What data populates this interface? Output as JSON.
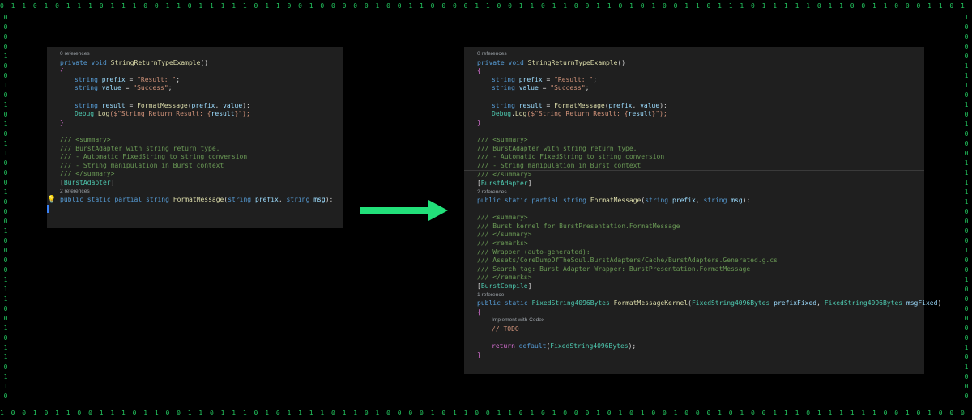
{
  "border": {
    "top": "0 1 1 0 1 0 1 1 1 0 1 1 1 0 0 1 1 0 1 1 1 1 1 0 1 1 0 0 1 0 0 0 0 0 1 0 0 1 1 0 0 0 0 1 1 0 0 1 1 0 1 1 0 0 1 1 0 1 0 1 0 0 1 1 0 1 1 1 0 1 1 1 1 1 0 1 1 0 0 1 1 0 0 0 1 1 0 1 1 0 1 1 1 1 1 1 0 1 1 0 1 0 0 1 1 1 1 1 1 0 0 1 1 0 1 0 0 1 1 1 0 1 1 0 0 0 0 1 0 0 0 0 1 1 0 0 0 1 1 0 0 0 1 1 0 0",
    "bottom": "1 0 0 1 0 1 1 0 0 1 1 1 0 1 1 0 0 1 1 0 1 1 1 0 1 0 1 1 1 1 0 1 1 0 1 0 0 0 0 1 0 1 1 0 0 1 1 0 1 0 1 0 0 0 1 0 1 0 1 0 0 1 0 0 0 1 0 1 0 0 1 1 1 0 1 1 1 1 1 1 0 0 1 0 1 0 0 0 1 0 1 0 1 0 1 1 0 0 1 1 1 0 1 0 1 0 0 0 1 1 0 1 0 1 1 1 1 1 1 0 1 0 1 0 1 0 1 1 1 0 1 0 0 0 1 0 0 1",
    "left": "0 0 0 0 1 0 0 1 0 1 0 1 0 1 1 0 0 0 1 0 0 0 1 0 0 0 0 1 1 1 0 0 1 0 1 1 0 1 1 0",
    "right": "1 0 0 0 0 1 1 1 0 1 0 1 0 0 0 1 1 1 1 1 0 0 0 0 1 0 0 1 0 0 0 0 0 0 1 0 1 0 0 0"
  },
  "left": {
    "refs0": "0 references",
    "sig": [
      "private",
      "void",
      "StringReturnTypeExample",
      "()"
    ],
    "open": "{",
    "l1": [
      "string",
      "prefix",
      " = ",
      "\"Result: \"",
      ";"
    ],
    "l2": [
      "string",
      "value",
      " = ",
      "\"Success\"",
      ";"
    ],
    "l3": [
      "string",
      "result",
      " = ",
      "FormatMessage",
      "(",
      "prefix",
      ", ",
      "value",
      ");"
    ],
    "l4": [
      "Debug",
      ".",
      "Log",
      "($\"String Return Result: {",
      "result",
      "}\");"
    ],
    "close": "}",
    "c1": "/// <summary>",
    "c2": "/// BurstAdapter with string return type.",
    "c3": "/// - Automatic FixedString to string conversion",
    "c4": "/// - String manipulation in Burst context",
    "c5": "/// </summary>",
    "attr": [
      "[",
      "BurstAdapter",
      "]"
    ],
    "refs2": "2 references",
    "decl": [
      "public",
      "static",
      "partial",
      "string",
      "FormatMessage",
      "(",
      "string",
      "prefix",
      ", ",
      "string",
      "msg",
      ");"
    ]
  },
  "right": {
    "refs0": "0 references",
    "sig": [
      "private",
      "void",
      "StringReturnTypeExample",
      "()"
    ],
    "open": "{",
    "l1": [
      "string",
      "prefix",
      " = ",
      "\"Result: \"",
      ";"
    ],
    "l2": [
      "string",
      "value",
      " = ",
      "\"Success\"",
      ";"
    ],
    "l3": [
      "string",
      "result",
      " = ",
      "FormatMessage",
      "(",
      "prefix",
      ", ",
      "value",
      ");"
    ],
    "l4": [
      "Debug",
      ".",
      "Log",
      "($\"String Return Result: {",
      "result",
      "}\");"
    ],
    "close": "}",
    "c1": "/// <summary>",
    "c2": "/// BurstAdapter with string return type.",
    "c3": "/// - Automatic FixedString to string conversion",
    "c4": "/// - String manipulation in Burst context",
    "c5": "/// </summary>",
    "attr": [
      "[",
      "BurstAdapter",
      "]"
    ],
    "refs2": "2 references",
    "decl": [
      "public",
      "static",
      "partial",
      "string",
      "FormatMessage",
      "(",
      "string",
      "prefix",
      ", ",
      "string",
      "msg",
      ");"
    ],
    "k1": "/// <summary>",
    "k2": "/// Burst kernel for BurstPresentation.FormatMessage",
    "k3": "/// </summary>",
    "k4": "/// <remarks>",
    "k5": "/// Wrapper (auto-generated):",
    "k6": "/// Assets/CoreDumpOfTheSoul.BurstAdapters/Cache/BurstAdapters.Generated.g.cs",
    "k7": "/// Search tag: Burst Adapter Wrapper: BurstPresentation.FormatMessage",
    "k8": "/// </remarks>",
    "attr2": [
      "[",
      "BurstCompile",
      "]"
    ],
    "refs1": "1 reference",
    "kernel": [
      "public",
      "static",
      "FixedString4096Bytes",
      "FormatMessageKernel",
      "(",
      "FixedString4096Bytes",
      "prefixFixed",
      ", ",
      "FixedString4096Bytes",
      "msgFixed",
      ")"
    ],
    "kopen": "{",
    "codex": "Implement with Codex",
    "todo": "// TODO",
    "ret": [
      "return",
      "default",
      "(",
      "FixedString4096Bytes",
      ");"
    ],
    "kclose": "}"
  },
  "colors": {
    "arrow": "#22e07a",
    "binary": "#22c55e"
  },
  "icons": {
    "bulb": "lightbulb-icon",
    "arrow": "right-arrow-icon"
  }
}
